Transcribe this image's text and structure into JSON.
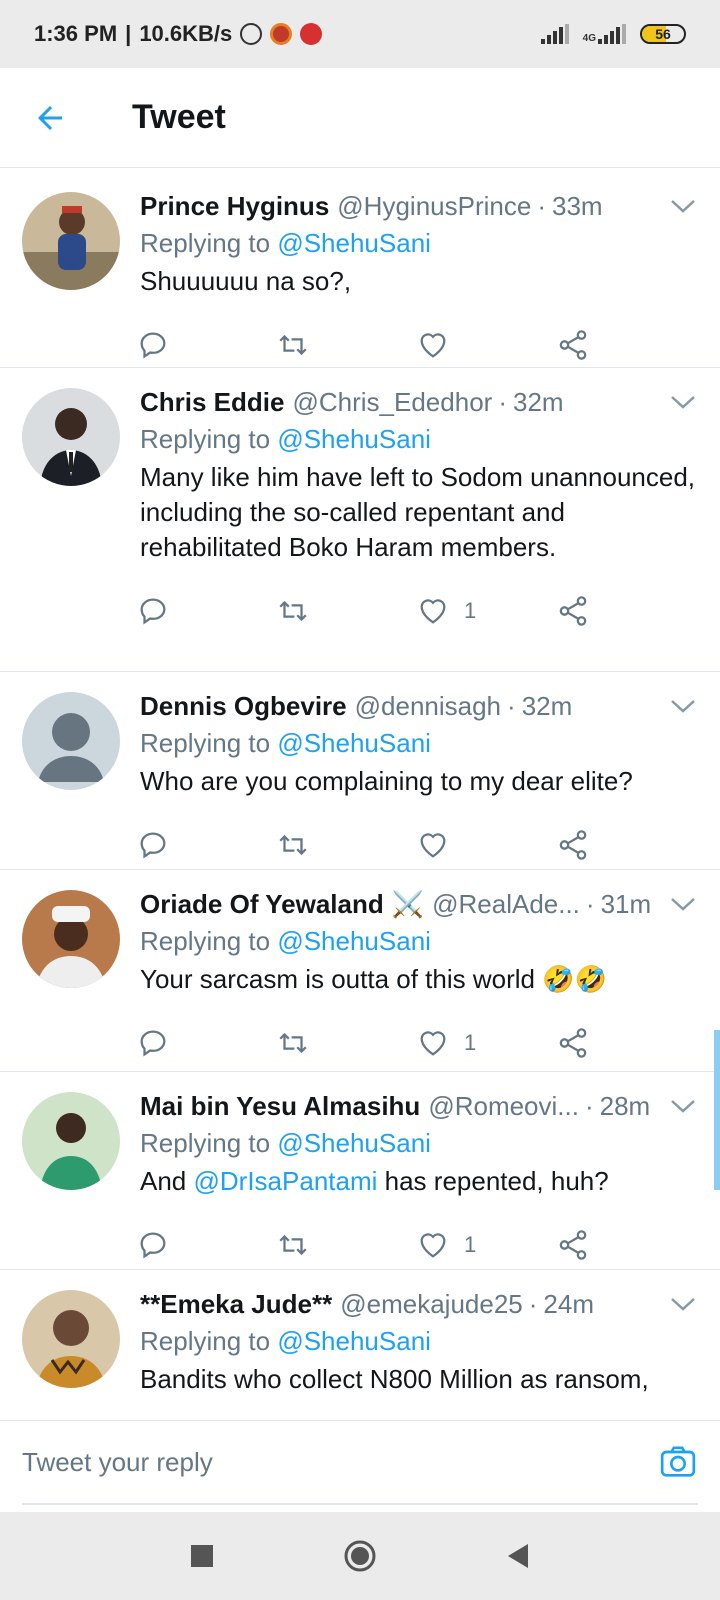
{
  "status_bar": {
    "time": "1:36 PM",
    "separator": "|",
    "speed": "10.6KB/s",
    "network": "4G",
    "battery_level": "56"
  },
  "header": {
    "title": "Tweet"
  },
  "reply_prefix": "Replying to",
  "tweets": [
    {
      "name": "Prince Hyginus",
      "handle": "@HyginusPrince",
      "time": "33m",
      "reply_to": "@ShehuSani",
      "text": "Shuuuuuu na so?,",
      "likes": ""
    },
    {
      "name": "Chris Eddie",
      "handle": "@Chris_Ededhor",
      "time": "32m",
      "reply_to": "@ShehuSani",
      "text": "Many like him have left to Sodom unannounced, including the so-called repentant and rehabilitated Boko Haram members.",
      "likes": "1"
    },
    {
      "name": "Dennis Ogbevire",
      "handle": "@dennisagh",
      "time": "32m",
      "reply_to": "@ShehuSani",
      "text": "Who are you complaining to my dear elite?",
      "likes": ""
    },
    {
      "name": "Oriade Of Yewaland",
      "name_emoji": "⚔️",
      "handle": "@RealAde...",
      "time": "31m",
      "reply_to": "@ShehuSani",
      "text": "Your sarcasm is outta of this world",
      "text_emoji": "🤣🤣",
      "likes": "1"
    },
    {
      "name": "Mai bin Yesu Almasihu",
      "handle": "@Romeovi...",
      "time": "28m",
      "reply_to": "@ShehuSani",
      "text_prefix": "And",
      "text_mention": "@DrIsaPantami",
      "text_suffix": "has repented, huh?",
      "likes": "1"
    },
    {
      "name": "**Emeka Jude**",
      "handle": "@emekajude25",
      "time": "24m",
      "reply_to": "@ShehuSani",
      "text": "Bandits who collect N800 Million as ransom,",
      "likes": ""
    }
  ],
  "reply_bar": {
    "placeholder": "Tweet your reply"
  },
  "colors": {
    "accent": "#1da1f2",
    "secondary_text": "#657786",
    "divider": "#e1e8ed"
  },
  "icons": {
    "actions": [
      "reply-icon",
      "retweet-icon",
      "like-icon",
      "share-icon"
    ],
    "header": "back-arrow-icon",
    "reply": "camera-icon",
    "nav": [
      "recents-icon",
      "home-icon",
      "back-icon"
    ]
  }
}
